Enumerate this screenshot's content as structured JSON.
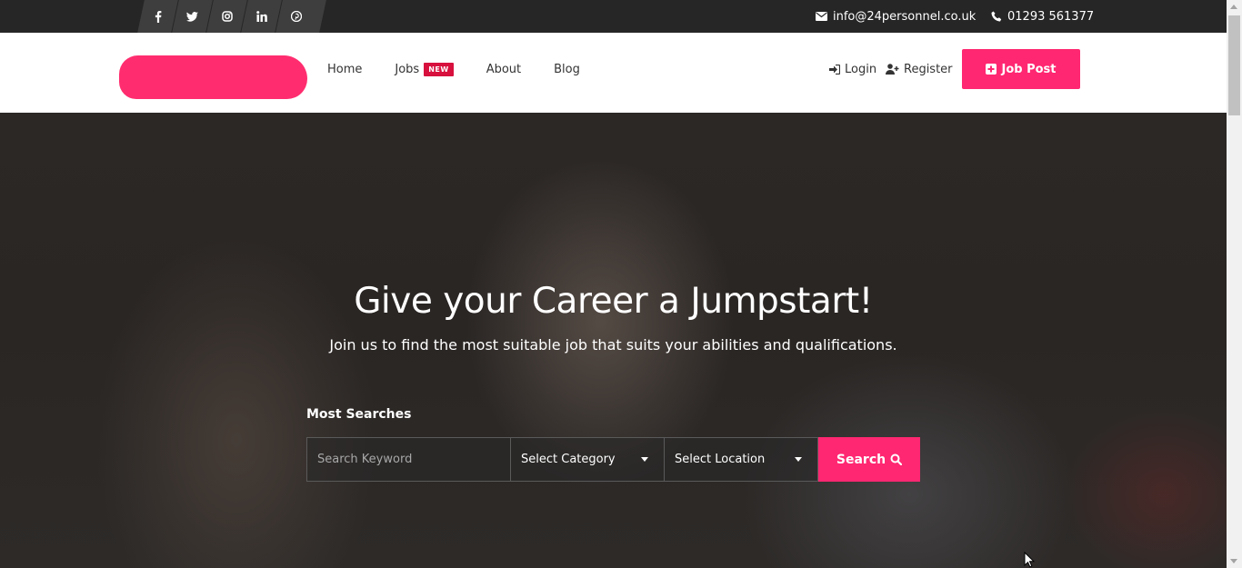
{
  "topbar": {
    "social": [
      {
        "name": "facebook-icon",
        "glyph": "f"
      },
      {
        "name": "twitter-icon",
        "glyph": "t"
      },
      {
        "name": "instagram-icon",
        "glyph": "ig"
      },
      {
        "name": "linkedin-icon",
        "glyph": "in"
      },
      {
        "name": "pinterest-icon",
        "glyph": "p"
      }
    ],
    "email": "info@24personnel.co.uk",
    "phone": "01293 561377",
    "email_icon": "envelope-icon",
    "phone_icon": "phone-icon"
  },
  "nav": {
    "links": [
      "Home",
      "Jobs",
      "About",
      "Blog"
    ],
    "jobs_badge": "NEW",
    "login": "Login",
    "register": "Register",
    "job_post": "Job Post"
  },
  "hero": {
    "title": "Give your Career a Jumpstart!",
    "subtitle": "Join us to find the most suitable job that suits your abilities and qualifications.",
    "most_searches": "Most Searches",
    "search_placeholder": "Search Keyword",
    "category_selected": "Select Category",
    "location_selected": "Select Location",
    "search_button": "Search"
  },
  "colors": {
    "accent": "#ff2771",
    "badge": "#d7103d",
    "topbar": "#262626"
  }
}
